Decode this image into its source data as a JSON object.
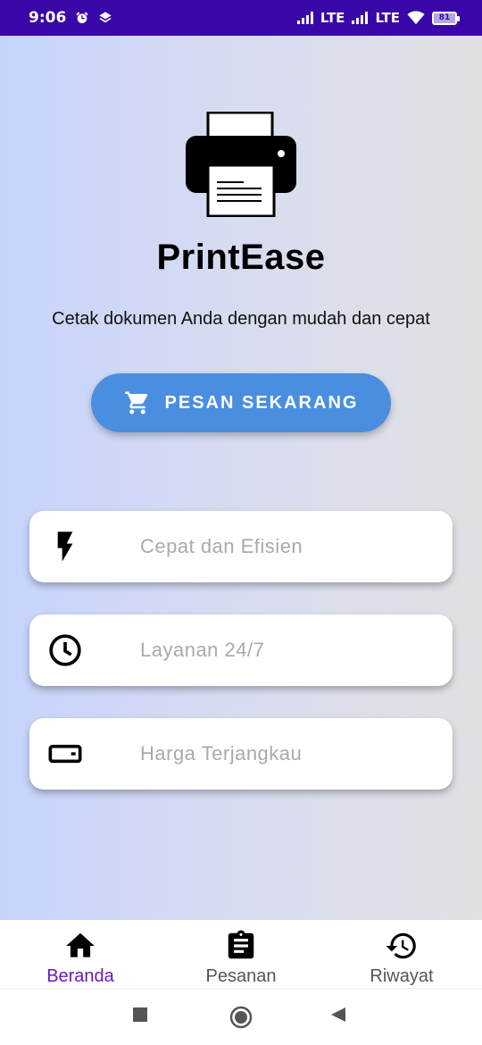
{
  "status_bar": {
    "time": "9:06",
    "network_1": "LTE",
    "network_2": "LTE",
    "battery": "81"
  },
  "app": {
    "title": "PrintEase",
    "tagline": "Cetak dokumen Anda dengan mudah dan cepat",
    "cta_label": "PESAN SEKARANG"
  },
  "features": [
    {
      "icon": "bolt-icon",
      "label": "Cepat dan Efisien"
    },
    {
      "icon": "clock-icon",
      "label": "Layanan 24/7"
    },
    {
      "icon": "wallet-icon",
      "label": "Harga Terjangkau"
    }
  ],
  "bottom_nav": [
    {
      "icon": "home-icon",
      "label": "Beranda",
      "active": true
    },
    {
      "icon": "clipboard-icon",
      "label": "Pesanan",
      "active": false
    },
    {
      "icon": "history-icon",
      "label": "Riwayat",
      "active": false
    }
  ],
  "colors": {
    "status_bar": "#3a06a8",
    "primary_button": "#4a8ee0",
    "active_nav": "#6a1bb8"
  }
}
